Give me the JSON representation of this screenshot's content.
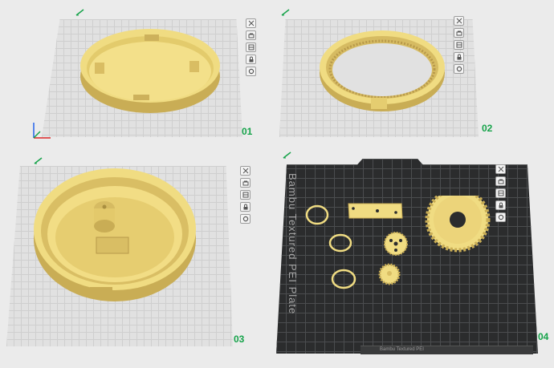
{
  "plates": [
    {
      "number": "01"
    },
    {
      "number": "02"
    },
    {
      "number": "03"
    },
    {
      "number": "04",
      "texture_label": "Bambu Textured PEI Plate"
    }
  ],
  "toolbar_icons": [
    "close-icon",
    "arrange-icon",
    "orient-icon",
    "lock-icon",
    "settings-icon"
  ],
  "status_strip": {
    "text": "Bambu Textured PEI"
  },
  "colors": {
    "filament": "#f0dc82",
    "plate_light": "#e1e1e1",
    "plate_dark": "#2b2c2d",
    "accent": "#16a34a"
  }
}
